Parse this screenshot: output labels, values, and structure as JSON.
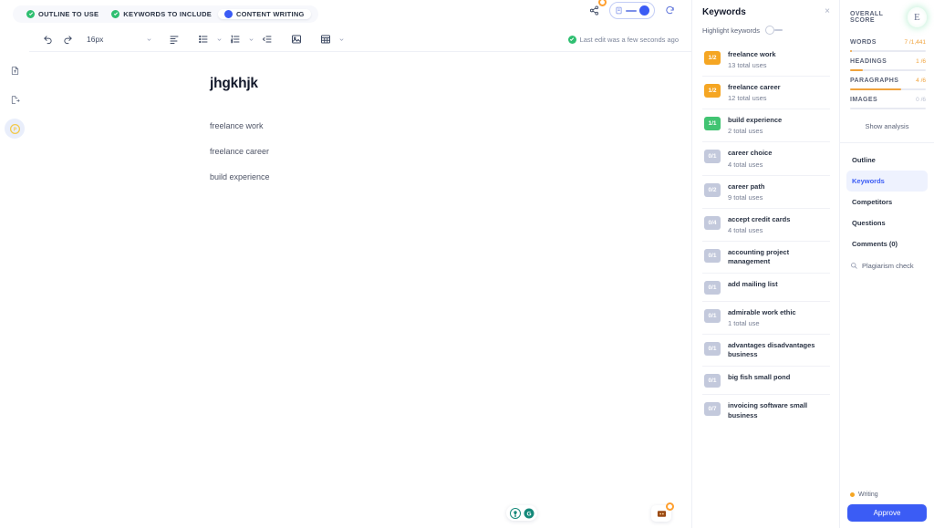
{
  "left_rail": {
    "items": [
      {
        "name": "import-document-icon",
        "active": false
      },
      {
        "name": "export-document-icon",
        "active": false
      },
      {
        "name": "credits-coin-icon",
        "active": true
      }
    ]
  },
  "chips": [
    {
      "label": "OUTLINE TO USE",
      "marker": "check",
      "selected": false
    },
    {
      "label": "KEYWORDS TO INCLUDE",
      "marker": "check",
      "selected": false
    },
    {
      "label": "CONTENT WRITING",
      "marker": "dot",
      "selected": true
    }
  ],
  "topright": {
    "share_icon": "share-icon",
    "share_has_badge": true,
    "mode_toggle_label": "document-mode-toggle",
    "restore_icon": "restore-icon"
  },
  "toolbar": {
    "undo": "undo-icon",
    "redo": "redo-icon",
    "font_size": "16px",
    "align": "align-left-icon",
    "bullet_list": "bullet-list-icon",
    "numbered_list": "numbered-list-icon",
    "indent": "indent-icon",
    "image": "insert-image-icon",
    "table": "insert-table-icon",
    "last_edit": "Last edit was a few seconds ago"
  },
  "document": {
    "title": "jhgkhjk",
    "paragraphs": [
      "freelance work",
      "freelance career",
      "build experience"
    ]
  },
  "keywords_panel": {
    "title": "Keywords",
    "close_label": "×",
    "highlight_label": "Highlight keywords",
    "highlight_on": false,
    "items": [
      {
        "count": "1/2",
        "tone": "orange",
        "name": "freelance work",
        "uses": "13 total uses"
      },
      {
        "count": "1/2",
        "tone": "orange",
        "name": "freelance career",
        "uses": "12 total uses"
      },
      {
        "count": "1/1",
        "tone": "green",
        "name": "build experience",
        "uses": "2 total uses"
      },
      {
        "count": "0/1",
        "tone": "gray",
        "name": "career choice",
        "uses": "4 total uses"
      },
      {
        "count": "0/2",
        "tone": "gray",
        "name": "career path",
        "uses": "9 total uses"
      },
      {
        "count": "0/4",
        "tone": "gray",
        "name": "accept credit cards",
        "uses": "4 total uses"
      },
      {
        "count": "0/1",
        "tone": "gray",
        "name": "accounting project management",
        "uses": ""
      },
      {
        "count": "0/1",
        "tone": "gray",
        "name": "add mailing list",
        "uses": ""
      },
      {
        "count": "0/1",
        "tone": "gray",
        "name": "admirable work ethic",
        "uses": "1 total use"
      },
      {
        "count": "0/1",
        "tone": "gray",
        "name": "advantages disadvantages business",
        "uses": ""
      },
      {
        "count": "0/1",
        "tone": "gray",
        "name": "big fish small pond",
        "uses": ""
      },
      {
        "count": "0/7",
        "tone": "gray",
        "name": "invoicing software small business",
        "uses": ""
      }
    ]
  },
  "score": {
    "header_label": "OVERALL SCORE",
    "letter": "E",
    "metrics": [
      {
        "name": "WORDS",
        "value": "7 /1,441",
        "percent": 3,
        "muted": false
      },
      {
        "name": "HEADINGS",
        "value": "1 /6",
        "percent": 17,
        "muted": false
      },
      {
        "name": "PARAGRAPHS",
        "value": "4 /6",
        "percent": 67,
        "muted": false
      },
      {
        "name": "IMAGES",
        "value": "0 /6",
        "percent": 0,
        "muted": true
      }
    ],
    "show_analysis": "Show analysis",
    "nav": [
      {
        "label": "Outline",
        "active": false
      },
      {
        "label": "Keywords",
        "active": true
      },
      {
        "label": "Competitors",
        "active": false
      },
      {
        "label": "Questions",
        "active": false
      },
      {
        "label": "Comments (0)",
        "active": false
      }
    ],
    "plagiarism": "Plagiarism check",
    "status": "Writing",
    "approve": "Approve"
  },
  "colors": {
    "accent_blue": "#3b5cf5",
    "orange": "#f5a623",
    "green": "#41c472",
    "gray_badge": "#c3c9dc"
  }
}
